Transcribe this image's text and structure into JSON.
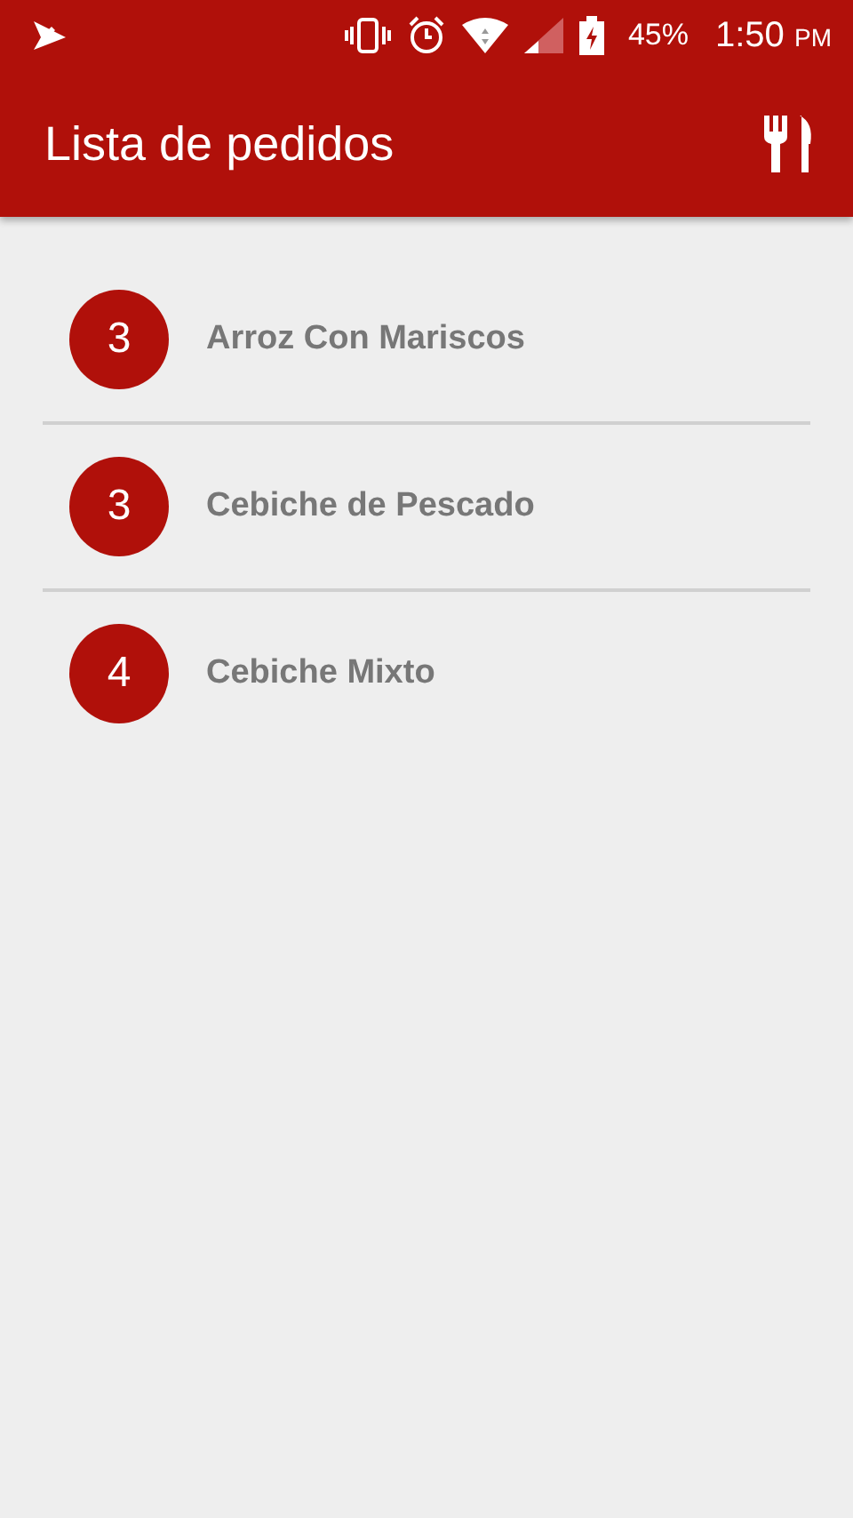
{
  "status_bar": {
    "battery": "45%",
    "time": "1:50",
    "time_suffix": "PM"
  },
  "app_bar": {
    "title": "Lista de pedidos"
  },
  "orders": [
    {
      "quantity": "3",
      "name": "Arroz Con Mariscos"
    },
    {
      "quantity": "3",
      "name": "Cebiche de Pescado"
    },
    {
      "quantity": "4",
      "name": "Cebiche Mixto"
    }
  ]
}
